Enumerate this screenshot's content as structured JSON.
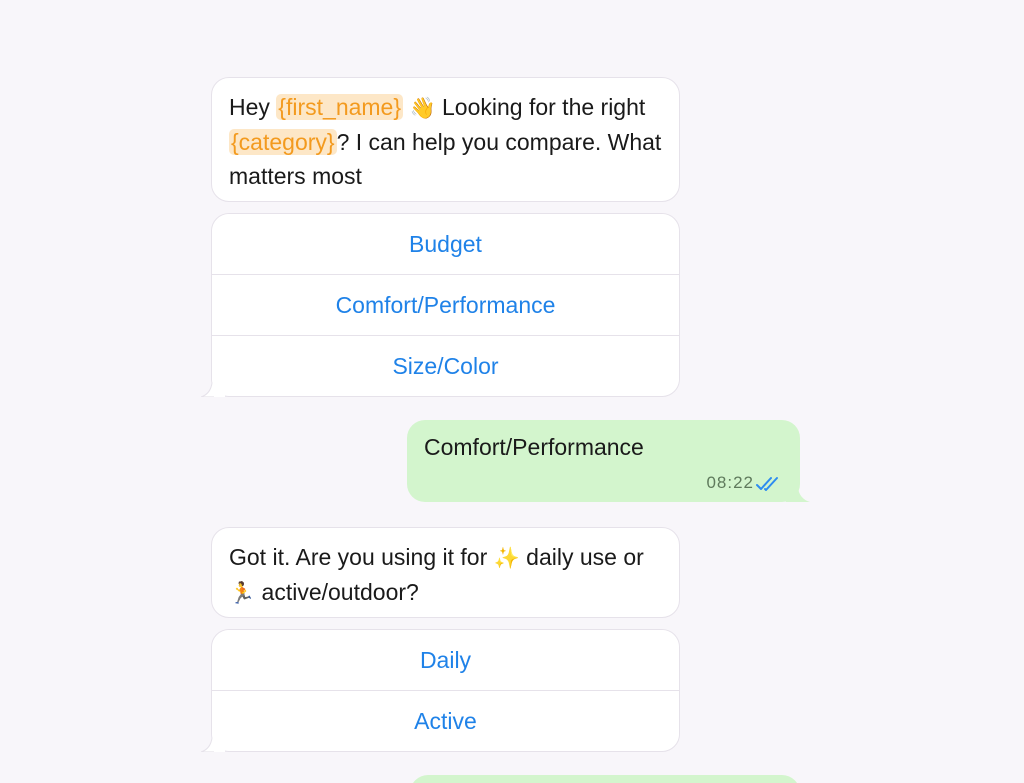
{
  "messages": {
    "greeting": {
      "part1": "Hey ",
      "tag_first_name": "{first_name}",
      "wave_emoji": "👋",
      "part2": " Looking for the right ",
      "tag_category": "{category}",
      "part3": "? I can help you compare. What matters most"
    },
    "greeting_options": [
      "Budget",
      "Comfort/Performance",
      "Size/Color"
    ],
    "reply_1": {
      "text": "Comfort/Performance",
      "time": "08:22",
      "status": "read-double-check-icon"
    },
    "usage_question": {
      "part1": "Got it. Are you using it for ",
      "sparkle_emoji": "✨",
      "part2": " daily use or ",
      "runner_emoji": "🏃",
      "part3": " active/outdoor?"
    },
    "usage_options": [
      "Daily",
      "Active"
    ]
  },
  "colors": {
    "background": "#f8f6fa",
    "incoming_bubble": "#ffffff",
    "outgoing_bubble": "#d3f5cd",
    "quick_reply_text": "#1f82e8",
    "tag_text": "#f39a1e",
    "tag_background": "#fde7c7",
    "read_ticks": "#2d8cf0"
  }
}
